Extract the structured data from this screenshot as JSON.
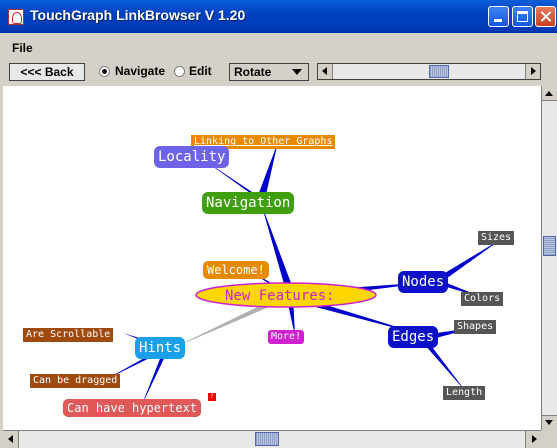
{
  "window": {
    "title": "TouchGraph LinkBrowser V 1.20"
  },
  "menu": {
    "file": "File"
  },
  "toolbar": {
    "back_label": "<<< Back",
    "navigate_label": "Navigate",
    "edit_label": "Edit",
    "mode_selected": "Navigate",
    "combo_value": "Rotate"
  },
  "graph": {
    "nodes": {
      "linking": "Linking to Other Graphs",
      "locality": "Locality",
      "navigation": "Navigation",
      "welcome": "Welcome!",
      "new_features": "New Features:",
      "nodes": "Nodes",
      "sizes": "Sizes",
      "colors": "Colors",
      "shapes": "Shapes",
      "edges": "Edges",
      "length": "Length",
      "more": "More!",
      "hints": "Hints",
      "scrollable": "Are Scrollable",
      "dragged": "Can be dragged",
      "hypertext": "Can have hypertext"
    },
    "colors": {
      "edge": "#0000cc",
      "edge_gray": "#b0b0b0",
      "orange": "#e88a00",
      "purple_blue": "#6d63e8",
      "green": "#3f9f0f",
      "yellow": "#ffd700",
      "magenta": "#d020d0",
      "navy": "#0c10c8",
      "gray_dark": "#555555",
      "cyan_blue": "#1b9fe8",
      "brown": "#a04a10",
      "red_pink": "#e05858"
    }
  }
}
